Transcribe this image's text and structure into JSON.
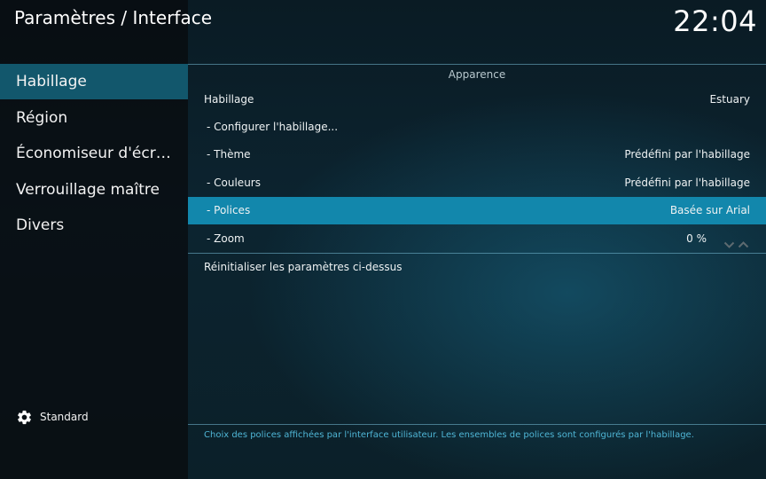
{
  "header": {
    "title": "Paramètres / Interface",
    "clock": "22:04"
  },
  "sidebar": {
    "items": [
      {
        "label": "Habillage",
        "active": true
      },
      {
        "label": "Région",
        "active": false
      },
      {
        "label": "Économiseur d'écr…",
        "active": false
      },
      {
        "label": "Verrouillage maître",
        "active": false
      },
      {
        "label": "Divers",
        "active": false
      }
    ],
    "level": {
      "icon": "gear-icon",
      "label": "Standard"
    }
  },
  "main": {
    "section_title": "Apparence",
    "settings": [
      {
        "label": "Habillage",
        "value": "Estuary"
      },
      {
        "label": "- Configurer l'habillage..."
      },
      {
        "label": "- Thème",
        "value": "Prédéfini par l'habillage"
      },
      {
        "label": "- Couleurs",
        "value": "Prédéfini par l'habillage"
      },
      {
        "label": "- Polices",
        "value": "Basée sur Arial",
        "focused": true
      },
      {
        "label": "- Zoom",
        "value": "0 %",
        "control": "spinner"
      }
    ],
    "reset_label": "Réinitialiser les paramètres ci-dessus",
    "help_text": "Choix des polices affichées par l'interface utilisateur. Les ensembles de polices sont configurés par l'habillage."
  },
  "colors": {
    "sidebar_selected": "#12576c",
    "row_focused": "#1287ac",
    "help_text": "#4fb6d6"
  }
}
